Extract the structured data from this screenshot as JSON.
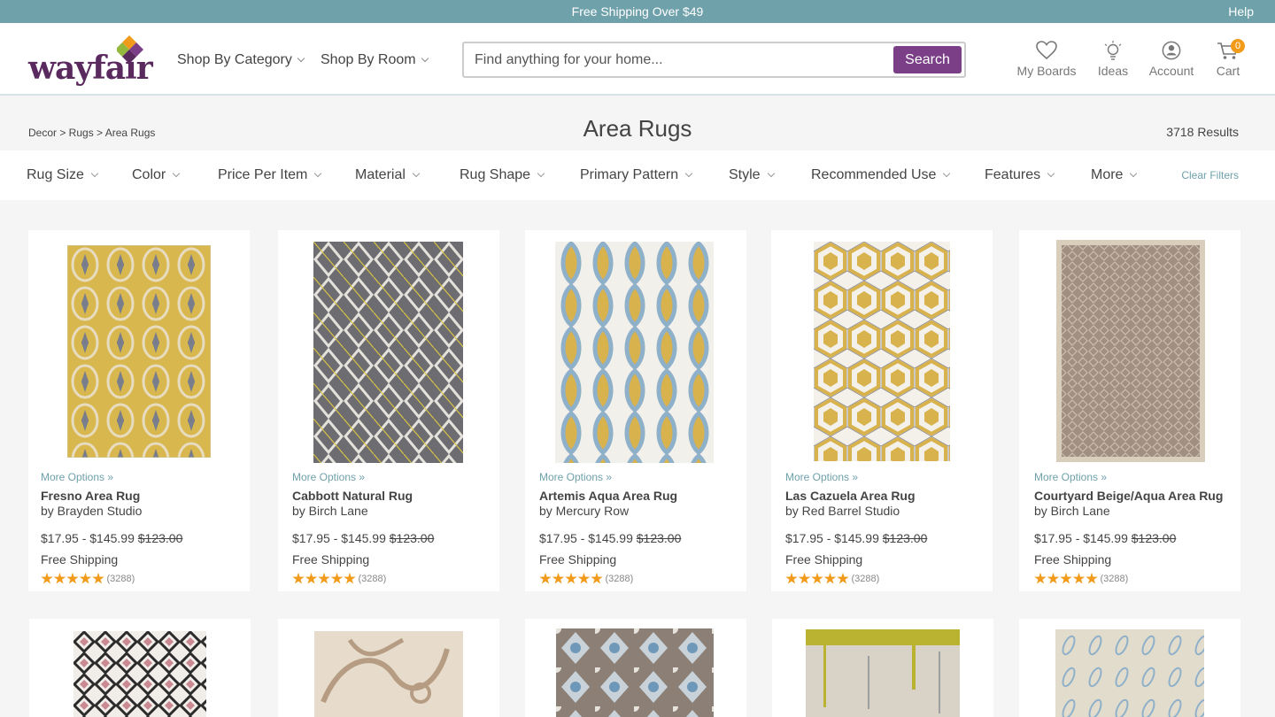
{
  "promo": {
    "text": "Free Shipping Over $49",
    "help": "Help"
  },
  "header": {
    "logo": "wayfair",
    "nav": [
      {
        "label": "Shop By Category"
      },
      {
        "label": "Shop By Room"
      }
    ],
    "search": {
      "placeholder": "Find anything for your home...",
      "button": "Search"
    },
    "icons": {
      "boards": "My Boards",
      "ideas": "Ideas",
      "account": "Account",
      "cart": "Cart",
      "cart_count": "0"
    }
  },
  "breadcrumb": "Decor > Rugs > Area Rugs",
  "page_title": "Area Rugs",
  "results": "3718 Results",
  "filters": [
    "Rug Size",
    "Color",
    "Price Per Item",
    "Material",
    "Rug Shape",
    "Primary Pattern",
    "Style",
    "Recommended Use",
    "Features",
    "More"
  ],
  "clear_filters": "Clear Filters",
  "colors": {
    "brand": "#7b3f88",
    "accent": "#6fa1ab",
    "star": "#f29b1b"
  },
  "products": [
    {
      "more": "More Options »",
      "name": "Fresno Area Rug",
      "brand": "by Brayden Studio",
      "price": "$17.95 - $145.99",
      "was": "$123.00",
      "shipping": "Free Shipping",
      "rating": 5,
      "reviews": "(3288)"
    },
    {
      "more": "More Options »",
      "name": "Cabbott Natural Rug",
      "brand": "by Birch Lane",
      "price": "$17.95 - $145.99",
      "was": "$123.00",
      "shipping": "Free Shipping",
      "rating": 5,
      "reviews": "(3288)"
    },
    {
      "more": "More Options »",
      "name": "Artemis Aqua Area Rug",
      "brand": "by Mercury Row",
      "price": "$17.95 - $145.99",
      "was": "$123.00",
      "shipping": "Free Shipping",
      "rating": 5,
      "reviews": "(3288)"
    },
    {
      "more": "More Options »",
      "name": "Las Cazuela Area Rug",
      "brand": "by Red Barrel Studio",
      "price": "$17.95 - $145.99",
      "was": "$123.00",
      "shipping": "Free Shipping",
      "rating": 5,
      "reviews": "(3288)"
    },
    {
      "more": "More Options »",
      "name": "Courtyard Beige/Aqua Area Rug",
      "brand": "by Birch Lane",
      "price": "$17.95 - $145.99",
      "was": "$123.00",
      "shipping": "Free Shipping",
      "rating": 5,
      "reviews": "(3288)"
    }
  ]
}
